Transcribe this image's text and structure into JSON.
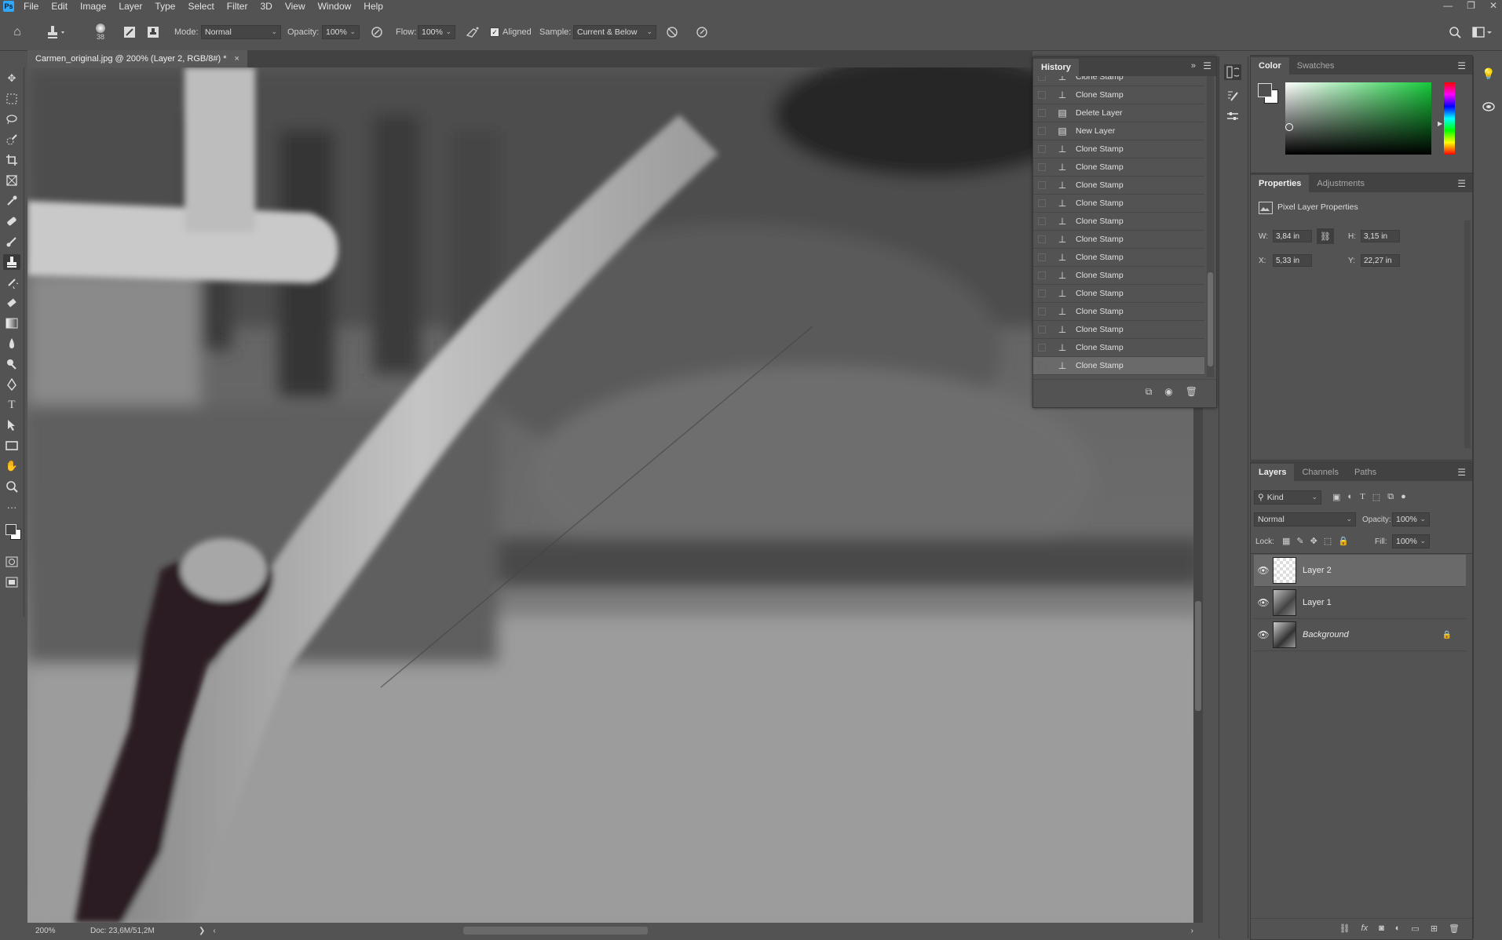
{
  "app": {
    "logo": "Ps"
  },
  "menu": [
    "File",
    "Edit",
    "Image",
    "Layer",
    "Type",
    "Select",
    "Filter",
    "3D",
    "View",
    "Window",
    "Help"
  ],
  "window_controls": [
    "—",
    "❐",
    "✕"
  ],
  "options": {
    "brush_size": "38",
    "mode_label": "Mode:",
    "mode_value": "Normal",
    "opacity_label": "Opacity:",
    "opacity_value": "100%",
    "flow_label": "Flow:",
    "flow_value": "100%",
    "aligned_label": "Aligned",
    "aligned_checked": true,
    "sample_label": "Sample:",
    "sample_value": "Current & Below"
  },
  "document_tab": {
    "title": "Carmen_original.jpg @ 200% (Layer 2, RGB/8#) *",
    "close": "×"
  },
  "status": {
    "zoom": "200%",
    "doc": "Doc: 23,6M/51,2M"
  },
  "history": {
    "tab": "History",
    "items": [
      "Clone Stamp",
      "Clone Stamp",
      "Delete Layer",
      "New Layer",
      "Clone Stamp",
      "Clone Stamp",
      "Clone Stamp",
      "Clone Stamp",
      "Clone Stamp",
      "Clone Stamp",
      "Clone Stamp",
      "Clone Stamp",
      "Clone Stamp",
      "Clone Stamp",
      "Clone Stamp",
      "Clone Stamp",
      "Clone Stamp"
    ],
    "item_icons": [
      "stamp",
      "stamp",
      "doc",
      "doc",
      "stamp",
      "stamp",
      "stamp",
      "stamp",
      "stamp",
      "stamp",
      "stamp",
      "stamp",
      "stamp",
      "stamp",
      "stamp",
      "stamp",
      "stamp"
    ]
  },
  "color_panel": {
    "tabs": [
      "Color",
      "Swatches"
    ]
  },
  "properties": {
    "tabs": [
      "Properties",
      "Adjustments"
    ],
    "heading": "Pixel Layer Properties",
    "w_label": "W:",
    "w_value": "3,84 in",
    "h_label": "H:",
    "h_value": "3,15 in",
    "x_label": "X:",
    "x_value": "5,33 in",
    "y_label": "Y:",
    "y_value": "22,27 in"
  },
  "layers_panel": {
    "tabs": [
      "Layers",
      "Channels",
      "Paths"
    ],
    "filter_kind": "Kind",
    "blend_mode": "Normal",
    "opacity_label": "Opacity:",
    "opacity_value": "100%",
    "lock_label": "Lock:",
    "fill_label": "Fill:",
    "fill_value": "100%",
    "layers": [
      "Layer 2",
      "Layer 1",
      "Background"
    ]
  }
}
